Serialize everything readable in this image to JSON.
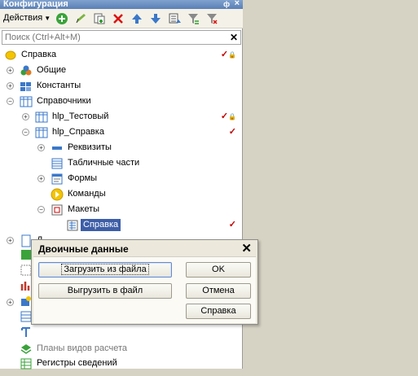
{
  "panel": {
    "title": "Конфигурация",
    "pin": "ф",
    "close": "×"
  },
  "toolbar": {
    "actions_label": "Действия",
    "icons": [
      "add-icon",
      "edit-icon",
      "copy-icon",
      "delete-icon",
      "move-up-icon",
      "move-down-icon",
      "sort-icon",
      "filter-icon",
      "clear-filter-icon"
    ]
  },
  "search": {
    "placeholder": "Поиск (Ctrl+Alt+M)",
    "value": ""
  },
  "tree": [
    {
      "label": "Справка",
      "icon": "help-icon"
    },
    {
      "label": "Общие",
      "icon": "common-icon"
    },
    {
      "label": "Константы",
      "icon": "constants-icon"
    },
    {
      "label": "Справочники",
      "icon": "catalogs-icon"
    },
    {
      "label": "hlp_Тестовый",
      "icon": "catalog-icon"
    },
    {
      "label": "hlp_Справка",
      "icon": "catalog-icon"
    },
    {
      "label": "Реквизиты",
      "icon": "attributes-icon"
    },
    {
      "label": "Табличные части",
      "icon": "tabular-icon"
    },
    {
      "label": "Формы",
      "icon": "forms-icon"
    },
    {
      "label": "Команды",
      "icon": "commands-icon"
    },
    {
      "label": "Макеты",
      "icon": "templates-icon"
    },
    {
      "label": "Справка",
      "icon": "template-icon"
    },
    {
      "label": "Д",
      "icon": "doc-icon"
    },
    {
      "label": "Планы видов расчета",
      "icon": "calc-plans-icon"
    },
    {
      "label": "Регистры сведений",
      "icon": "registers-icon"
    }
  ],
  "dialog": {
    "title": "Двоичные данные",
    "load_button": "Загрузить из файла",
    "save_button": "Выгрузить в файл",
    "ok_button": "OK",
    "cancel_button": "Отмена",
    "help_button": "Справка"
  },
  "colors": {
    "selection": "#3d5ea8",
    "title_bar": "#6a8fc4",
    "check_mark": "#c00000"
  }
}
